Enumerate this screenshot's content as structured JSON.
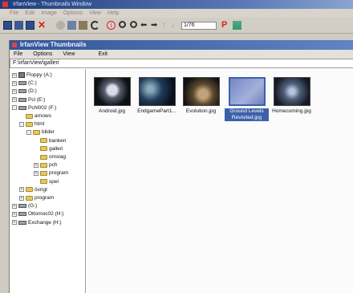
{
  "outer": {
    "title": "IrfanView - Thumbnails Window",
    "menu": [
      "File",
      "Edit",
      "Image",
      "Options",
      "View",
      "Help"
    ],
    "toolbar": {
      "page_counter": "1/76"
    }
  },
  "thumbs_window": {
    "title": "IrfanView Thumbnails",
    "menu": [
      "File",
      "Options",
      "View"
    ],
    "exit_label": "Exit",
    "path": "F:\\irfanView\\galleri"
  },
  "tree": [
    {
      "label": "Floppy (A:)",
      "depth": 0,
      "kind": "floppy",
      "exp": "+"
    },
    {
      "label": "(C:)",
      "depth": 0,
      "kind": "drive",
      "exp": "+"
    },
    {
      "label": "(D:)",
      "depth": 0,
      "kind": "drive",
      "exp": "+"
    },
    {
      "label": "Pcl (E:)",
      "depth": 0,
      "kind": "drive",
      "exp": "+"
    },
    {
      "label": "Pchl002 (F:)",
      "depth": 0,
      "kind": "drive",
      "exp": "-"
    },
    {
      "label": "arnows",
      "depth": 1,
      "kind": "folder",
      "exp": ""
    },
    {
      "label": "html",
      "depth": 1,
      "kind": "folder",
      "exp": "-"
    },
    {
      "label": "bilder",
      "depth": 2,
      "kind": "folder",
      "exp": "-"
    },
    {
      "label": "banken",
      "depth": 3,
      "kind": "folder",
      "exp": ""
    },
    {
      "label": "galleri",
      "depth": 3,
      "kind": "folder",
      "exp": ""
    },
    {
      "label": "omslag",
      "depth": 3,
      "kind": "folder",
      "exp": ""
    },
    {
      "label": "pch",
      "depth": 3,
      "kind": "folder",
      "exp": "+"
    },
    {
      "label": "program",
      "depth": 3,
      "kind": "folder",
      "exp": "+"
    },
    {
      "label": "spel",
      "depth": 3,
      "kind": "folder",
      "exp": ""
    },
    {
      "label": "övrigt",
      "depth": 1,
      "kind": "folder",
      "exp": "+"
    },
    {
      "label": "program",
      "depth": 1,
      "kind": "folder",
      "exp": "+"
    },
    {
      "label": "(G:)",
      "depth": 0,
      "kind": "drive",
      "exp": "+"
    },
    {
      "label": "Ottomoc02 (H:)",
      "depth": 0,
      "kind": "drive",
      "exp": "+"
    },
    {
      "label": "Exchange (H:)",
      "depth": 0,
      "kind": "drive",
      "exp": "+"
    }
  ],
  "thumbnails": [
    {
      "caption": "Android.jpg",
      "style": "img-android",
      "selected": false
    },
    {
      "caption": "EndgamePart1...",
      "style": "img-endgame",
      "selected": false
    },
    {
      "caption": "Evolution.jpg",
      "style": "img-evolution",
      "selected": false
    },
    {
      "caption": "Ground Levels Revisited.jpg",
      "style": "img-ground",
      "selected": true
    },
    {
      "caption": "Homecoming.jpg",
      "style": "img-homecoming",
      "selected": false
    }
  ],
  "colors": {
    "title_bar": "#31549a",
    "selection": "#3d61a8",
    "folder": "#e5c85a"
  }
}
